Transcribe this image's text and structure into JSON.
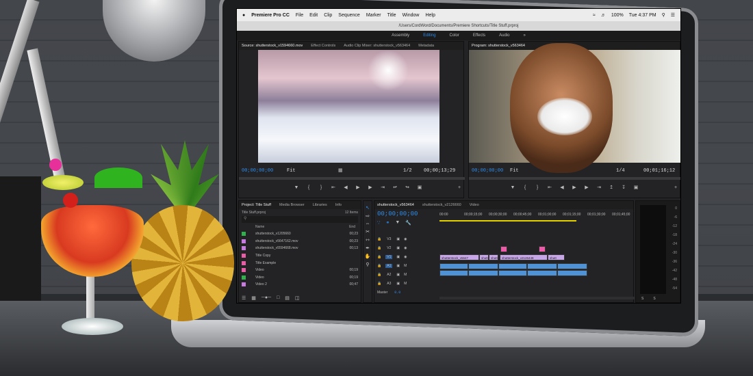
{
  "menubar": {
    "apple": "",
    "app_name": "Premiere Pro CC",
    "items": [
      "File",
      "Edit",
      "Clip",
      "Sequence",
      "Marker",
      "Title",
      "Window",
      "Help"
    ],
    "battery": "100%",
    "clock": "Tue 4:37 PM"
  },
  "path": "/Users/CordWord/Documents/Premiere Shortcuts/Title Stuff.prproj",
  "workspaces": [
    "Assembly",
    "Editing",
    "Color",
    "Effects",
    "Audio",
    "»"
  ],
  "source": {
    "tabs": [
      "Source: shutterstock_v1594660.mov",
      "Effect Controls",
      "Audio Clip Mixer: shutterstock_v563464",
      "Metadata"
    ],
    "timecode_in": "00;00;00;00",
    "fit": "Fit",
    "scale": "1/2",
    "timecode_out": "00;00;13;29"
  },
  "program": {
    "tab": "Program: shutterstock_v563464",
    "timecode_in": "00;00;00;00",
    "fit": "Fit",
    "scale": "1/4",
    "timecode_out": "00;01;16;12"
  },
  "project": {
    "tabs": [
      "Project: Title Stuff",
      "Media Browser",
      "Libraries",
      "Info"
    ],
    "file": "Title Stuff.prproj",
    "count": "12 Items",
    "col_name": "Name",
    "col_end": "End",
    "rows": [
      {
        "name": "shutterstock_v1205660",
        "end": "00;23",
        "color": "#2db34a"
      },
      {
        "name": "shutterstock_v5647162.mov",
        "end": "00;23",
        "color": "#c77ae0"
      },
      {
        "name": "shutterstock_v5594668.mov",
        "end": "00;13",
        "color": "#c77ae0"
      },
      {
        "name": "Title Copy",
        "end": "",
        "color": "#ea5ba8"
      },
      {
        "name": "Title Example",
        "end": "",
        "color": "#ea5ba8"
      },
      {
        "name": "Video",
        "end": "00;19",
        "color": "#ea5ba8"
      },
      {
        "name": "Video",
        "end": "00;19",
        "color": "#2db34a"
      },
      {
        "name": "Video 2",
        "end": "00;47",
        "color": "#c77ae0"
      }
    ]
  },
  "timeline": {
    "tabs": [
      "shutterstock_v563464",
      "shutterstock_v2126660",
      "Video"
    ],
    "timecode": "00;00;00;00",
    "ruler": [
      "00:00",
      "00;00;15;00",
      "00;00;30;00",
      "00;00;45;00",
      "00;01;00;00",
      "00;01;15;00",
      "00;01;30;00",
      "00;01;45;00"
    ],
    "tracks": [
      "V3",
      "V2",
      "V1",
      "A1",
      "A2",
      "A3"
    ],
    "master_label": "Master",
    "master_value": "0.0",
    "clips_v1": [
      "shutterstock_v5647",
      "shutt",
      "shutt",
      "shutterstock_v2126448",
      "shutt"
    ]
  },
  "meters": [
    "0",
    "-6",
    "-12",
    "-18",
    "-24",
    "-30",
    "-36",
    "-42",
    "-48",
    "-54"
  ],
  "meter_footer": [
    "S",
    "S"
  ],
  "colors": {
    "accent_blue": "#2d8ceb",
    "clip_video": "#c7a6e8",
    "clip_audio": "#4f93d6",
    "clip_pink": "#ea5ba8"
  }
}
